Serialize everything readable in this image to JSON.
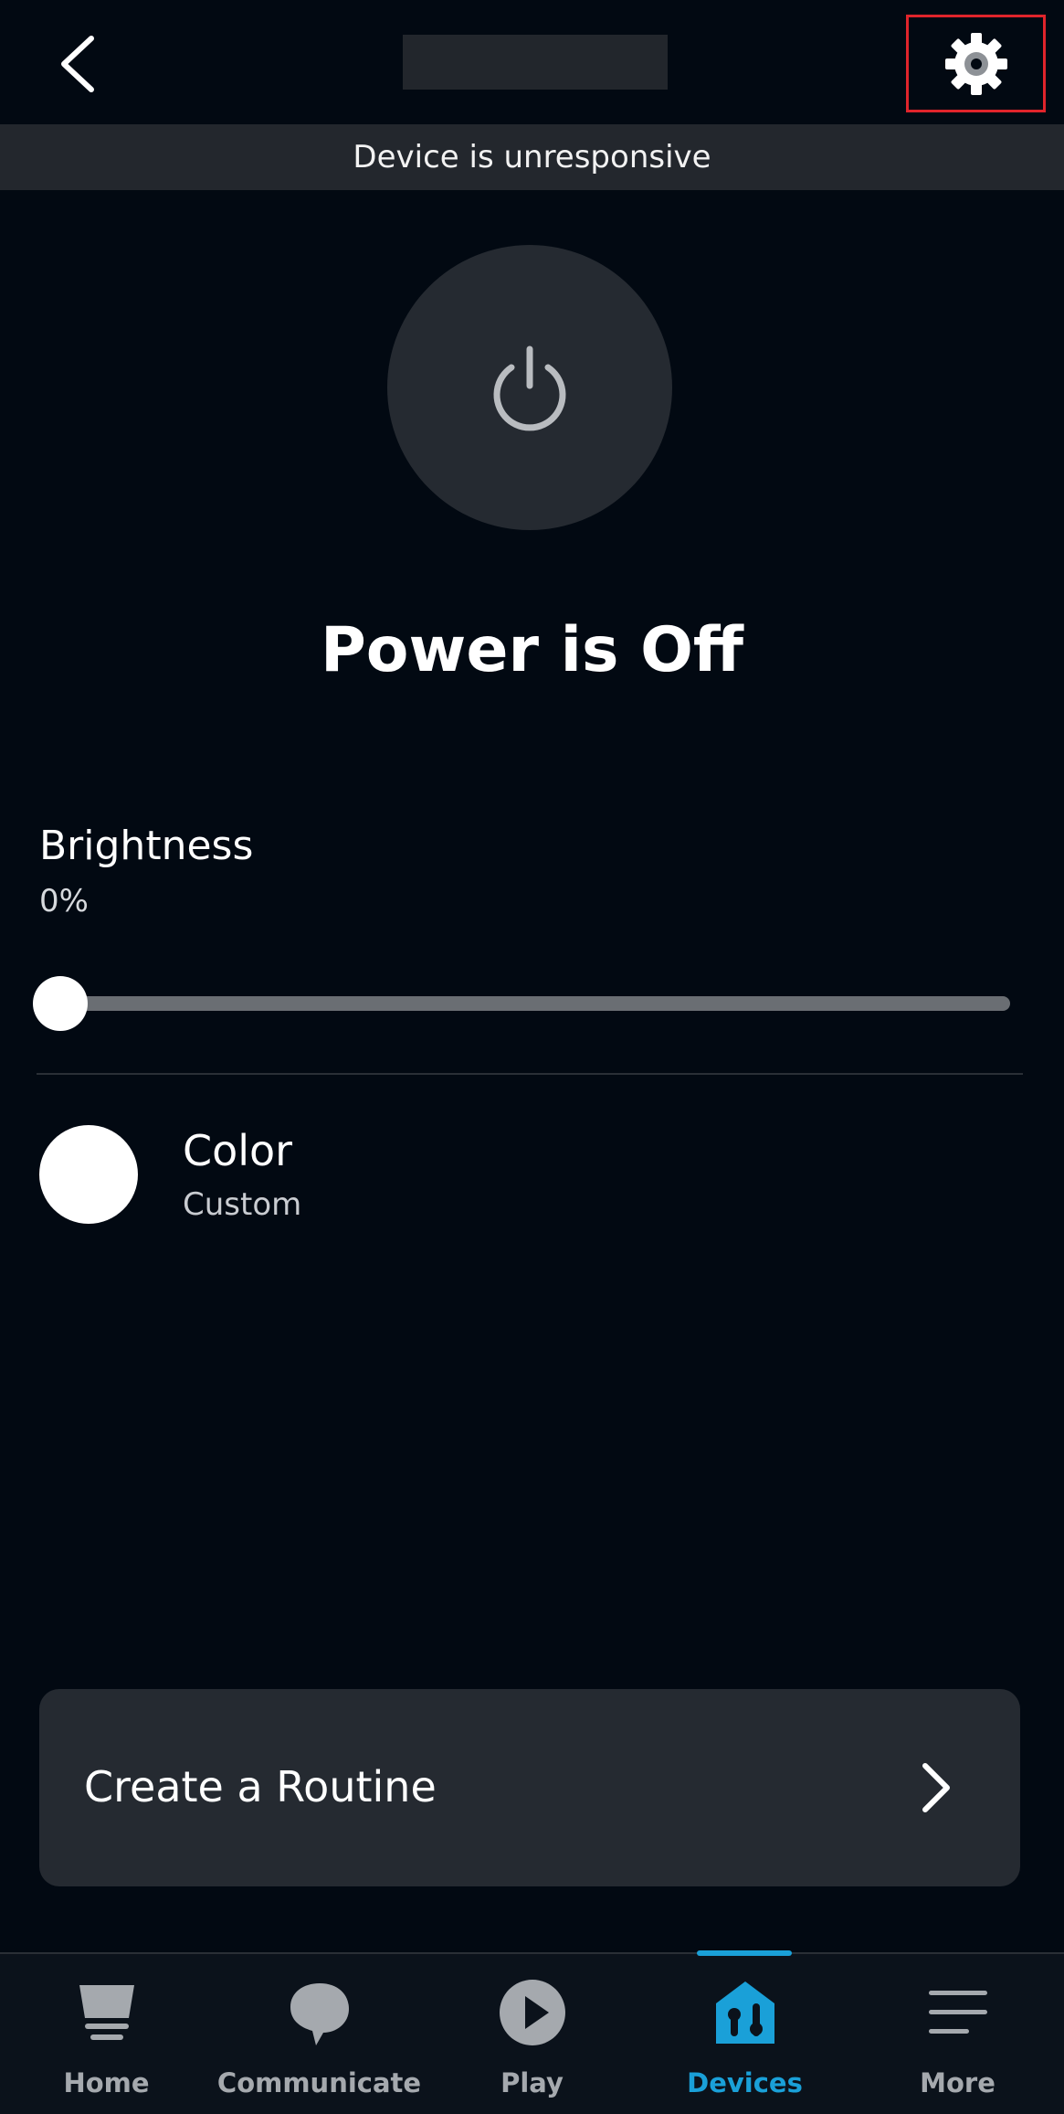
{
  "header": {
    "back_icon": "chevron-left-icon",
    "settings_icon": "gear-icon"
  },
  "status": {
    "text": "Device is unresponsive"
  },
  "power": {
    "icon": "power-icon",
    "state_text": "Power is Off"
  },
  "brightness": {
    "label": "Brightness",
    "value_text": "0%",
    "value": 0
  },
  "color": {
    "label": "Color",
    "sub": "Custom",
    "swatch": "#ffffff"
  },
  "routine": {
    "label": "Create a Routine",
    "chevron_icon": "chevron-right-icon"
  },
  "nav": {
    "items": [
      {
        "label": "Home",
        "icon": "home-icon"
      },
      {
        "label": "Communicate",
        "icon": "chat-bubble-icon"
      },
      {
        "label": "Play",
        "icon": "play-icon"
      },
      {
        "label": "Devices",
        "icon": "devices-icon",
        "active": true
      },
      {
        "label": "More",
        "icon": "menu-icon"
      }
    ]
  },
  "colors": {
    "background": "#020912",
    "surface": "#252a31",
    "accent": "#1aa0d8",
    "highlight_border": "#e0242b"
  }
}
